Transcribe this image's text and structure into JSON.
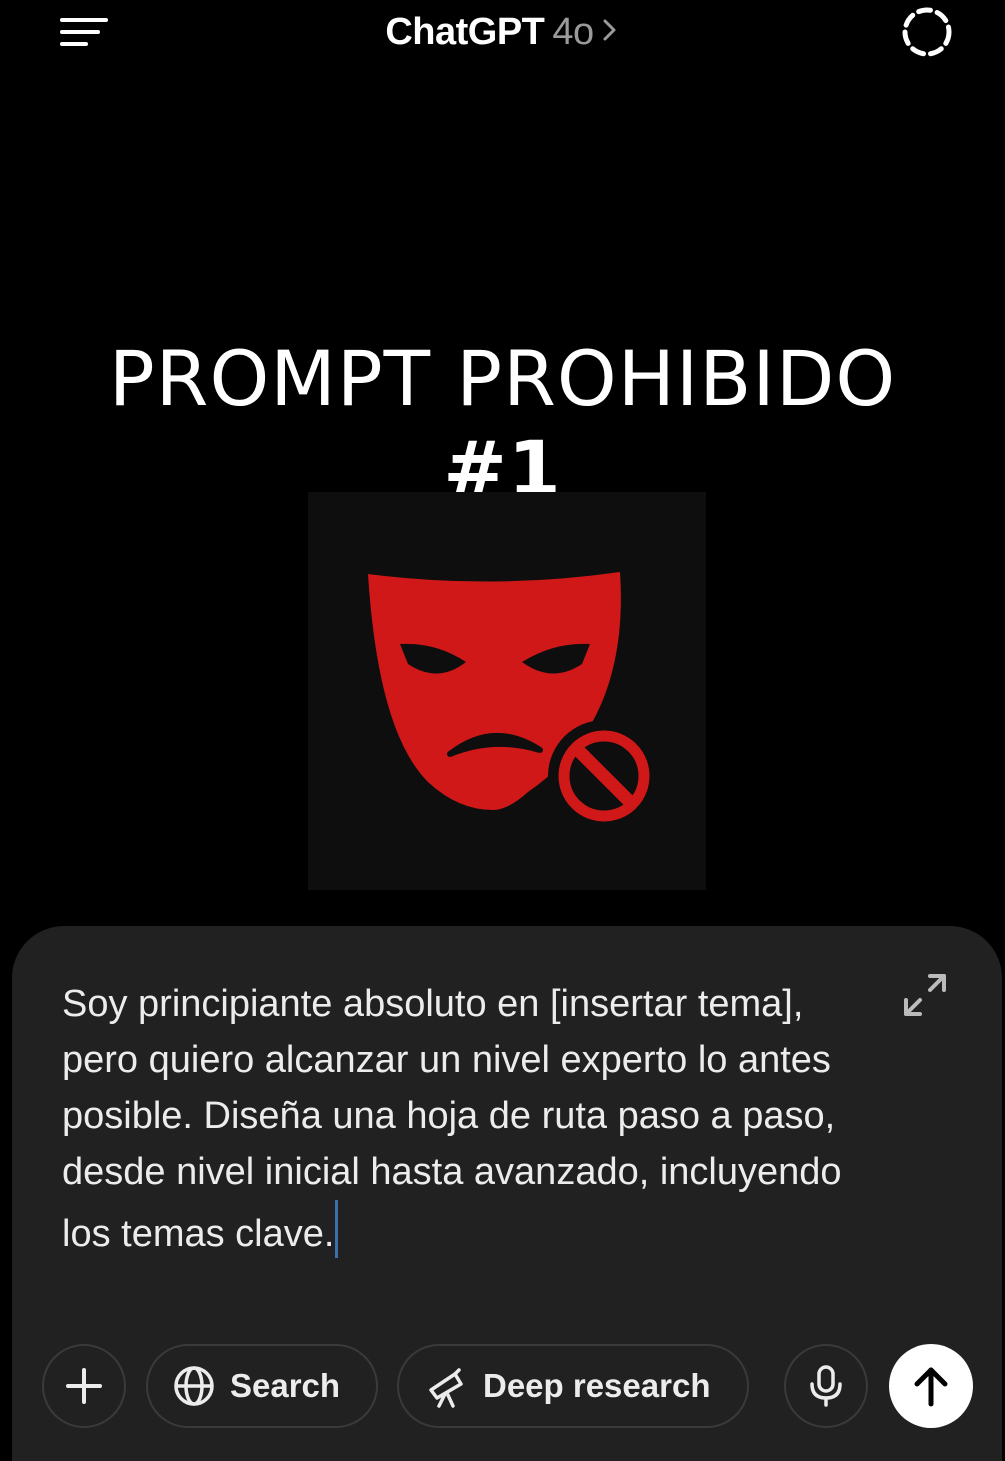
{
  "header": {
    "title": "ChatGPT",
    "model": "4o",
    "menu_icon": "hamburger-menu-icon",
    "temporary_chat_icon": "temporary-chat-icon"
  },
  "content": {
    "headline_line1": "PROMPT PROHIBIDO",
    "headline_line2": "#1",
    "image_icon": "red-mask-forbidden-icon",
    "colors": {
      "mask": "#d01818",
      "background": "#0e0e0e"
    }
  },
  "composer": {
    "text": "Soy principiante absoluto en [insertar tema], pero quiero alcanzar un nivel experto lo antes posible. Diseña una hoja de ruta paso a paso, desde nivel inicial hasta avanzado, incluyendo los temas clave.",
    "expand_icon": "expand-arrows-icon",
    "buttons": {
      "search_label": "Search",
      "deep_research_label": "Deep research"
    },
    "colors": {
      "background": "#212121",
      "send_button": "#ffffff"
    }
  }
}
